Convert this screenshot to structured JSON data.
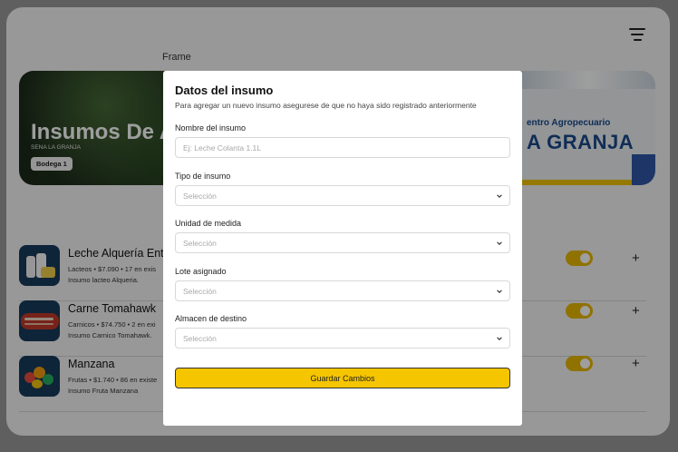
{
  "app": {
    "frame_label": "Frame",
    "banner": {
      "title": "Insumos De A",
      "subtitle": "SENA LA GRANJA",
      "badge": "Bodega 1",
      "sign_line1": "entro Agropecuario",
      "sign_line2": "A GRANJA"
    },
    "items": [
      {
        "name": "Leche Alquería Ente",
        "meta": "Lacteos • $7.090 • 17 en exis",
        "desc": "Insumo lacteo Alqueria.",
        "icon": "milk-icon",
        "active": true
      },
      {
        "name": "Carne Tomahawk",
        "meta": "Carnicos • $74.750 • 2 en exi",
        "desc": "Insumo Carnico Tomahawk.",
        "icon": "meat-icon",
        "active": true
      },
      {
        "name": "Manzana",
        "meta": "Frutas • $1.740 • 86 en existe",
        "desc": "Insumo Fruta Manzana",
        "icon": "fruit-icon",
        "active": true
      }
    ],
    "plus_label": "+"
  },
  "modal": {
    "title": "Datos del insumo",
    "subtitle": "Para agregar un nuevo insumo asegurese de que no haya sido registrado anteriormente",
    "fields": {
      "name": {
        "label": "Nombre del insumo",
        "placeholder": "Ej: Leche Colanta 1.1L",
        "value": ""
      },
      "type": {
        "label": "Tipo de insumo",
        "selected": "Selección"
      },
      "unit": {
        "label": "Unidad de medida",
        "selected": "Selección"
      },
      "lot": {
        "label": "Lote asignado",
        "selected": "Selección"
      },
      "warehouse": {
        "label": "Almacen de destino",
        "selected": "Selección"
      }
    },
    "save_label": "Guardar Cambios"
  },
  "colors": {
    "accent": "#f5c500",
    "toggle": "#e8b800",
    "overlay": "rgba(0,0,0,0.38)"
  }
}
